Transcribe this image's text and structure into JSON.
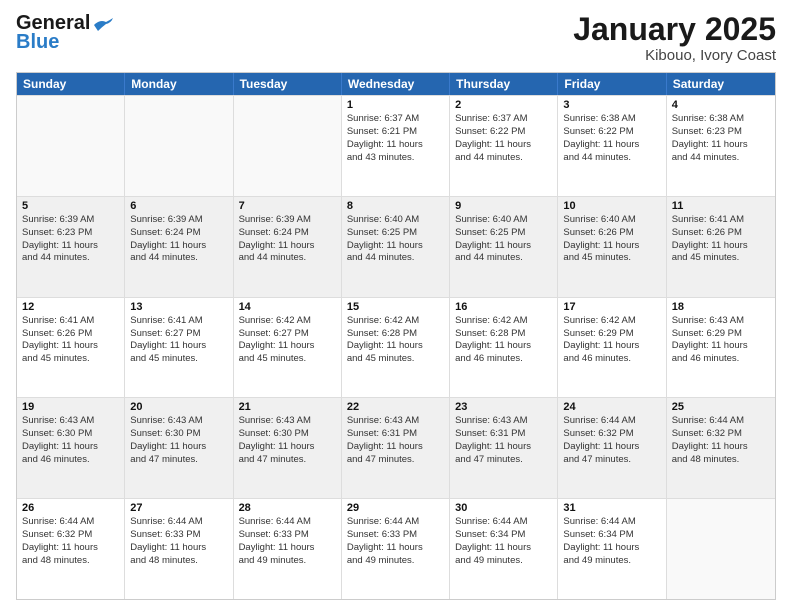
{
  "header": {
    "logo_line1": "General",
    "logo_line2": "Blue",
    "main_title": "January 2025",
    "subtitle": "Kibouo, Ivory Coast"
  },
  "days_of_week": [
    "Sunday",
    "Monday",
    "Tuesday",
    "Wednesday",
    "Thursday",
    "Friday",
    "Saturday"
  ],
  "rows": [
    [
      {
        "day": "",
        "text": ""
      },
      {
        "day": "",
        "text": ""
      },
      {
        "day": "",
        "text": ""
      },
      {
        "day": "1",
        "text": "Sunrise: 6:37 AM\nSunset: 6:21 PM\nDaylight: 11 hours\nand 43 minutes."
      },
      {
        "day": "2",
        "text": "Sunrise: 6:37 AM\nSunset: 6:22 PM\nDaylight: 11 hours\nand 44 minutes."
      },
      {
        "day": "3",
        "text": "Sunrise: 6:38 AM\nSunset: 6:22 PM\nDaylight: 11 hours\nand 44 minutes."
      },
      {
        "day": "4",
        "text": "Sunrise: 6:38 AM\nSunset: 6:23 PM\nDaylight: 11 hours\nand 44 minutes."
      }
    ],
    [
      {
        "day": "5",
        "text": "Sunrise: 6:39 AM\nSunset: 6:23 PM\nDaylight: 11 hours\nand 44 minutes."
      },
      {
        "day": "6",
        "text": "Sunrise: 6:39 AM\nSunset: 6:24 PM\nDaylight: 11 hours\nand 44 minutes."
      },
      {
        "day": "7",
        "text": "Sunrise: 6:39 AM\nSunset: 6:24 PM\nDaylight: 11 hours\nand 44 minutes."
      },
      {
        "day": "8",
        "text": "Sunrise: 6:40 AM\nSunset: 6:25 PM\nDaylight: 11 hours\nand 44 minutes."
      },
      {
        "day": "9",
        "text": "Sunrise: 6:40 AM\nSunset: 6:25 PM\nDaylight: 11 hours\nand 44 minutes."
      },
      {
        "day": "10",
        "text": "Sunrise: 6:40 AM\nSunset: 6:26 PM\nDaylight: 11 hours\nand 45 minutes."
      },
      {
        "day": "11",
        "text": "Sunrise: 6:41 AM\nSunset: 6:26 PM\nDaylight: 11 hours\nand 45 minutes."
      }
    ],
    [
      {
        "day": "12",
        "text": "Sunrise: 6:41 AM\nSunset: 6:26 PM\nDaylight: 11 hours\nand 45 minutes."
      },
      {
        "day": "13",
        "text": "Sunrise: 6:41 AM\nSunset: 6:27 PM\nDaylight: 11 hours\nand 45 minutes."
      },
      {
        "day": "14",
        "text": "Sunrise: 6:42 AM\nSunset: 6:27 PM\nDaylight: 11 hours\nand 45 minutes."
      },
      {
        "day": "15",
        "text": "Sunrise: 6:42 AM\nSunset: 6:28 PM\nDaylight: 11 hours\nand 45 minutes."
      },
      {
        "day": "16",
        "text": "Sunrise: 6:42 AM\nSunset: 6:28 PM\nDaylight: 11 hours\nand 46 minutes."
      },
      {
        "day": "17",
        "text": "Sunrise: 6:42 AM\nSunset: 6:29 PM\nDaylight: 11 hours\nand 46 minutes."
      },
      {
        "day": "18",
        "text": "Sunrise: 6:43 AM\nSunset: 6:29 PM\nDaylight: 11 hours\nand 46 minutes."
      }
    ],
    [
      {
        "day": "19",
        "text": "Sunrise: 6:43 AM\nSunset: 6:30 PM\nDaylight: 11 hours\nand 46 minutes."
      },
      {
        "day": "20",
        "text": "Sunrise: 6:43 AM\nSunset: 6:30 PM\nDaylight: 11 hours\nand 47 minutes."
      },
      {
        "day": "21",
        "text": "Sunrise: 6:43 AM\nSunset: 6:30 PM\nDaylight: 11 hours\nand 47 minutes."
      },
      {
        "day": "22",
        "text": "Sunrise: 6:43 AM\nSunset: 6:31 PM\nDaylight: 11 hours\nand 47 minutes."
      },
      {
        "day": "23",
        "text": "Sunrise: 6:43 AM\nSunset: 6:31 PM\nDaylight: 11 hours\nand 47 minutes."
      },
      {
        "day": "24",
        "text": "Sunrise: 6:44 AM\nSunset: 6:32 PM\nDaylight: 11 hours\nand 47 minutes."
      },
      {
        "day": "25",
        "text": "Sunrise: 6:44 AM\nSunset: 6:32 PM\nDaylight: 11 hours\nand 48 minutes."
      }
    ],
    [
      {
        "day": "26",
        "text": "Sunrise: 6:44 AM\nSunset: 6:32 PM\nDaylight: 11 hours\nand 48 minutes."
      },
      {
        "day": "27",
        "text": "Sunrise: 6:44 AM\nSunset: 6:33 PM\nDaylight: 11 hours\nand 48 minutes."
      },
      {
        "day": "28",
        "text": "Sunrise: 6:44 AM\nSunset: 6:33 PM\nDaylight: 11 hours\nand 49 minutes."
      },
      {
        "day": "29",
        "text": "Sunrise: 6:44 AM\nSunset: 6:33 PM\nDaylight: 11 hours\nand 49 minutes."
      },
      {
        "day": "30",
        "text": "Sunrise: 6:44 AM\nSunset: 6:34 PM\nDaylight: 11 hours\nand 49 minutes."
      },
      {
        "day": "31",
        "text": "Sunrise: 6:44 AM\nSunset: 6:34 PM\nDaylight: 11 hours\nand 49 minutes."
      },
      {
        "day": "",
        "text": ""
      }
    ]
  ]
}
